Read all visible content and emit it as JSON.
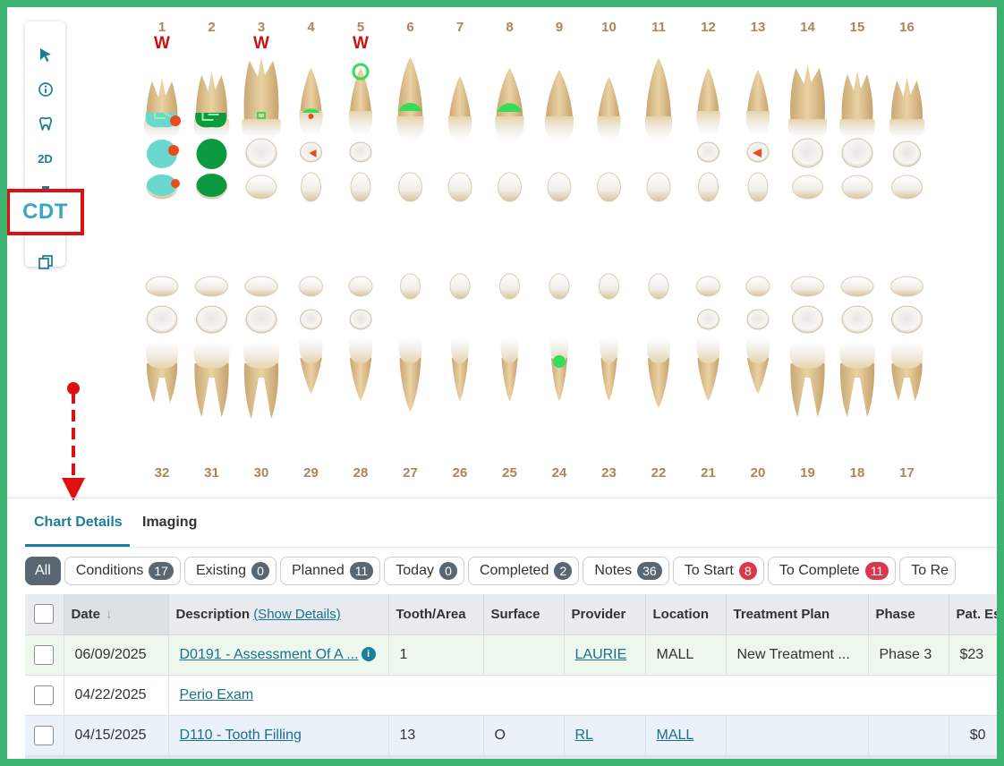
{
  "toolbar": {
    "items": [
      "select-arrow-icon",
      "info-icon",
      "tooth-icon",
      "2D",
      "print-icon",
      "copy-icon"
    ],
    "view_2d_label": "2D",
    "cdt_label": "CDT"
  },
  "teeth_chart": {
    "upper_numbers": [
      "1",
      "2",
      "3",
      "4",
      "5",
      "6",
      "7",
      "8",
      "9",
      "10",
      "11",
      "12",
      "13",
      "14",
      "15",
      "16"
    ],
    "lower_numbers": [
      "32",
      "31",
      "30",
      "29",
      "28",
      "27",
      "26",
      "25",
      "24",
      "23",
      "22",
      "21",
      "20",
      "19",
      "18",
      "17"
    ],
    "w_mark": "W",
    "w_teeth": [
      "1",
      "3",
      "5"
    ]
  },
  "tabs": [
    {
      "label": "Chart Details",
      "active": true
    },
    {
      "label": "Imaging",
      "active": false
    }
  ],
  "filters": [
    {
      "label": "All",
      "count": null,
      "active": true
    },
    {
      "label": "Conditions",
      "count": "17"
    },
    {
      "label": "Existing",
      "count": "0"
    },
    {
      "label": "Planned",
      "count": "11"
    },
    {
      "label": "Today",
      "count": "0"
    },
    {
      "label": "Completed",
      "count": "2"
    },
    {
      "label": "Notes",
      "count": "36"
    },
    {
      "label": "To Start",
      "count": "8",
      "alert": true
    },
    {
      "label": "To Complete",
      "count": "11",
      "alert": true
    },
    {
      "label": "To Re",
      "count": null
    }
  ],
  "table": {
    "columns": {
      "date": "Date",
      "description": "Description",
      "show_details": "(Show Details)",
      "tooth": "Tooth/Area",
      "surface": "Surface",
      "provider": "Provider",
      "location": "Location",
      "plan": "Treatment Plan",
      "phase": "Phase",
      "pat": "Pat. Es"
    },
    "rows": [
      {
        "date": "06/09/2025",
        "description": "D0191 - Assessment Of A ...",
        "tooth": "1",
        "surface": "",
        "provider": "LAURIE",
        "location": "MALL",
        "plan": "New Treatment ...",
        "phase": "Phase 3",
        "pat": "$23"
      },
      {
        "date": "04/22/2025",
        "description": "Perio Exam",
        "tooth": "",
        "surface": "",
        "provider": "",
        "location": "",
        "plan": "",
        "phase": "",
        "pat": ""
      },
      {
        "date": "04/15/2025",
        "description": "D110 - Tooth Filling",
        "tooth": "13",
        "surface": "O",
        "provider": "RL",
        "location": "MALL",
        "plan": "",
        "phase": "",
        "pat": "$0"
      }
    ]
  },
  "colors": {
    "frame": "#3cb371",
    "accent": "#1a7f9c",
    "highlight": "#dd1111",
    "tooth_number": "#b08458",
    "filling": "#33dd55",
    "condition_teal": "#6ad8cf",
    "crown_green": "#0c9a40",
    "decay": "#e84c1e"
  }
}
